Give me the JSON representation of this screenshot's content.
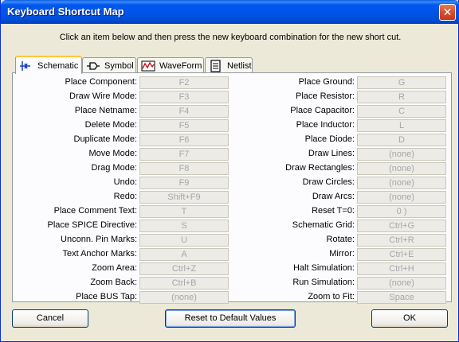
{
  "window": {
    "title": "Keyboard Shortcut Map",
    "close_glyph": "✕",
    "instruction": "Click an item below and then press the new keyboard combination for the new short cut."
  },
  "tabs": [
    {
      "label": "Schematic",
      "icon": "schematic-icon",
      "active": true
    },
    {
      "label": "Symbol",
      "icon": "symbol-icon",
      "active": false
    },
    {
      "label": "WaveForm",
      "icon": "waveform-icon",
      "active": false
    },
    {
      "label": "Netlist",
      "icon": "netlist-icon",
      "active": false
    }
  ],
  "shortcuts_left": [
    {
      "label": "Place Component:",
      "value": "F2"
    },
    {
      "label": "Draw Wire Mode:",
      "value": "F3"
    },
    {
      "label": "Place Netname:",
      "value": "F4"
    },
    {
      "label": "Delete Mode:",
      "value": "F5"
    },
    {
      "label": "Duplicate Mode:",
      "value": "F6"
    },
    {
      "label": "Move Mode:",
      "value": "F7"
    },
    {
      "label": "Drag Mode:",
      "value": "F8"
    },
    {
      "label": "Undo:",
      "value": "F9"
    },
    {
      "label": "Redo:",
      "value": "Shift+F9"
    },
    {
      "label": "Place Comment Text:",
      "value": "T"
    },
    {
      "label": "Place SPICE Directive:",
      "value": "S"
    },
    {
      "label": "Unconn. Pin Marks:",
      "value": "U"
    },
    {
      "label": "Text Anchor Marks:",
      "value": "A"
    },
    {
      "label": "Zoom Area:",
      "value": "Ctrl+Z"
    },
    {
      "label": "Zoom Back:",
      "value": "Ctrl+B"
    },
    {
      "label": "Place BUS Tap:",
      "value": "(none)"
    }
  ],
  "shortcuts_right": [
    {
      "label": "Place Ground:",
      "value": "G"
    },
    {
      "label": "Place Resistor:",
      "value": "R"
    },
    {
      "label": "Place Capacitor:",
      "value": "C"
    },
    {
      "label": "Place Inductor:",
      "value": "L"
    },
    {
      "label": "Place Diode:",
      "value": "D"
    },
    {
      "label": "Draw Lines:",
      "value": "(none)"
    },
    {
      "label": "Draw Rectangles:",
      "value": "(none)"
    },
    {
      "label": "Draw Circles:",
      "value": "(none)"
    },
    {
      "label": "Draw Arcs:",
      "value": "(none)"
    },
    {
      "label": "Reset T=0:",
      "value": "0 )"
    },
    {
      "label": "Schematic Grid:",
      "value": "Ctrl+G"
    },
    {
      "label": "Rotate:",
      "value": "Ctrl+R"
    },
    {
      "label": "Mirror:",
      "value": "Ctrl+E"
    },
    {
      "label": "Halt Simulation:",
      "value": "Ctrl+H"
    },
    {
      "label": "Run Simulation:",
      "value": "(none)"
    },
    {
      "label": "Zoom to Fit:",
      "value": "Space"
    }
  ],
  "buttons": {
    "cancel": "Cancel",
    "reset": "Reset to Default Values",
    "ok": "OK"
  }
}
